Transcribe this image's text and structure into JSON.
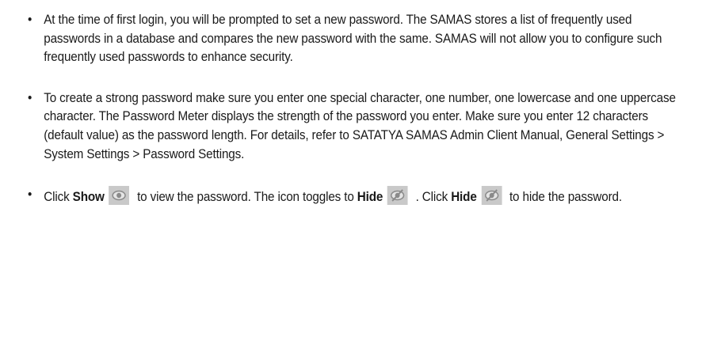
{
  "bullets": [
    {
      "text": "At the time of first login, you will be prompted to set a new password. The SAMAS stores a list of frequently used passwords in a database and compares the new password with the same. SAMAS will not allow you to configure such frequently used passwords to enhance security."
    },
    {
      "text": "To create a strong password make sure you enter one special character, one number, one lowercase and one uppercase character. The Password Meter displays the strength of the password you enter. Make sure you enter 12 characters (default value) as the password length. For details, refer to SATATYA SAMAS Admin Client Manual, General Settings > System Settings > Password Settings."
    },
    {
      "p1": "Click ",
      "show": "Show",
      "p2": " to view the password. The icon toggles to ",
      "hide1": "Hide",
      "p3": " . Click ",
      "hide2": "Hide",
      "p4": " to hide the password."
    }
  ],
  "bullet_symbol": "•",
  "icons": {
    "show": "eye-icon",
    "hide": "eye-slash-icon",
    "tile_color": "#c9c9c9",
    "glyph_color": "#8a8a8a"
  }
}
